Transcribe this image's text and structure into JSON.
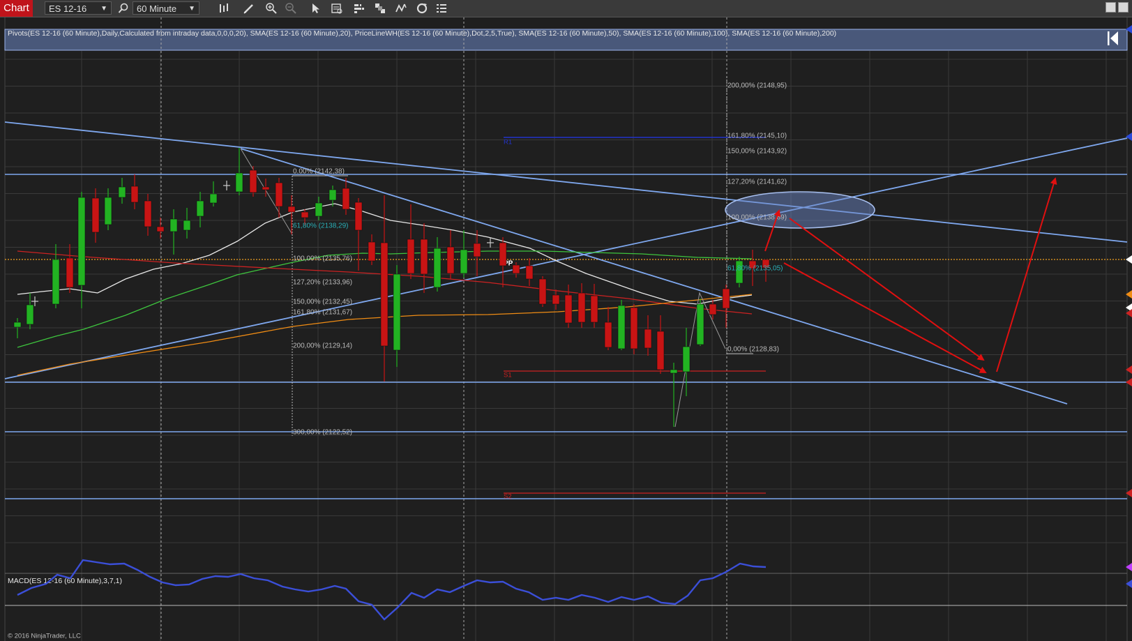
{
  "toolbar": {
    "chart_label": "Chart",
    "instrument": "ES 12-16",
    "period": "60 Minute"
  },
  "indicators_label": "Pivots(ES 12-16 (60 Minute),Daily,Calculated from intraday data,0,0,0,20), SMA(ES 12-16 (60 Minute),20), PriceLineWH(ES 12-16 (60 Minute),Dot,2,5,True), SMA(ES 12-16 (60 Minute),50), SMA(ES 12-16 (60 Minute),100), SMA(ES 12-16 (60 Minute),200)",
  "macd_label": "MACD(ES 12-16 (60 Minute),3,7,1)",
  "copyright": "© 2016 NinjaTrader, LLC",
  "pivots": {
    "r1": "R1",
    "pp": "PP",
    "s1": "S1",
    "s2": "S2"
  },
  "fib_left": [
    "0.00% (2142,38)",
    "61,80% (2138,29)",
    "100,00% (2135,76)",
    "127,20% (2133,96)",
    "150,00% (2132,45)",
    "161,80% (2131,67)",
    "200,00% (2129,14)",
    "300,00% (2122,52)"
  ],
  "fib_right": [
    "200,00% (2148,95)",
    "161,80% (2145,10)",
    "150,00% (2143,92)",
    "127,20% (2141,62)",
    "100,00% (2138,89)",
    "61,80% (2135,05)",
    "0,00% (2128,83)"
  ],
  "colors": {
    "background": "#1f1f1f",
    "grid": "#3a3a3a",
    "up_candle": "#22b322",
    "down_candle": "#c81414",
    "trendline": "#7fa8ef",
    "arrow": "#e01010",
    "sma20": "#e8e8e8",
    "sma50": "#3ec53e",
    "sma100": "#cc2222",
    "sma200": "#f08c14",
    "macd": "#3b4fd8",
    "pivot_r1": "#2233cc",
    "pivot_s": "#cc2020",
    "price_line": "#f0a020"
  }
}
